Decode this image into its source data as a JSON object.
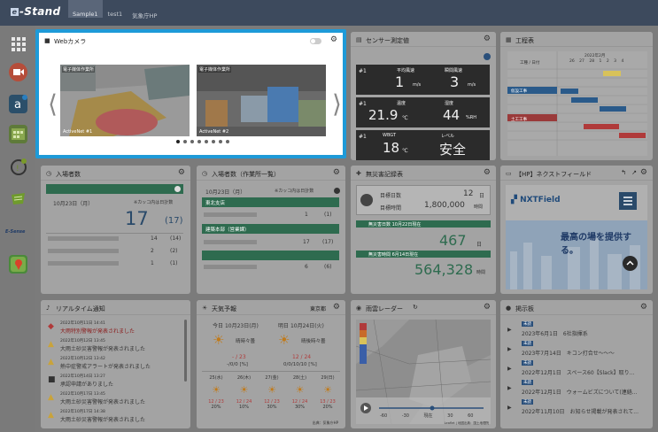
{
  "app": {
    "logo_mark": "e",
    "logo_text": "-Stand"
  },
  "tabs": [
    {
      "label": "Sample1"
    },
    {
      "label": "test1"
    },
    {
      "label": "気象庁HP"
    }
  ],
  "sidebar": {
    "esense_label": "E-Sense"
  },
  "webcam": {
    "title": "Webカメラ",
    "cams": [
      {
        "title": "電子媒体作業所",
        "caption": "ActiveNet #1"
      },
      {
        "title": "電子媒体作業所",
        "caption": "ActiveNet #2"
      }
    ],
    "dots": 8
  },
  "sensor": {
    "title": "センサー測定値",
    "blocks": [
      {
        "id": "#1",
        "labels": [
          "平均風速",
          "瞬間風速"
        ],
        "values": [
          "1",
          "3"
        ],
        "units": [
          "m/s",
          "m/s"
        ]
      },
      {
        "id": "#1",
        "labels": [
          "温度",
          "湿度"
        ],
        "values": [
          "21.9",
          "44"
        ],
        "units": [
          "℃",
          "%RH"
        ]
      },
      {
        "id": "#1",
        "labels": [
          "WBGT",
          "レベル"
        ],
        "values": [
          "18",
          "安全"
        ],
        "units": [
          "℃",
          ""
        ]
      }
    ]
  },
  "schedule": {
    "title": "工程表",
    "month": "2022年2月",
    "col_label": "工種 / 日付",
    "days": [
      "26",
      "27",
      "28",
      "1",
      "2",
      "3",
      "4"
    ],
    "rows": [
      "準備",
      "仮設工事",
      "杭打工事",
      "既製杭工事",
      "躯体工事",
      "鉄骨工事",
      "土工事1",
      "土工事2",
      "土工事3"
    ],
    "row_labels": [
      "仮設工事",
      "基礎工事",
      "土工工事",
      "鉄筋工事"
    ]
  },
  "entry": {
    "title": "入場者数",
    "date": "10月23日（月）",
    "note": "※カッコ内は日計数",
    "total": "17",
    "total_sub": "(17)",
    "rows": [
      {
        "v": "14",
        "s": "(14)"
      },
      {
        "v": "2",
        "s": "(2)"
      },
      {
        "v": "1",
        "s": "(1)"
      }
    ]
  },
  "entry_site": {
    "title": "入場者数（作業所一覧）",
    "date": "10月23日（月）",
    "note": "※カッコ内は日計数",
    "groups": [
      {
        "name": "東北支店",
        "v": "1",
        "s": "(1)"
      },
      {
        "name": "建築本部（営業課）",
        "v": "17",
        "s": "(17)"
      },
      {
        "name": "",
        "v": "6",
        "s": "(6)"
      }
    ]
  },
  "safety": {
    "title": "無災害記録表",
    "labels": [
      "目標日数",
      "目標時間"
    ],
    "goal_days": "12",
    "goal_days_unit": "日",
    "goal_hours": "1,800,000",
    "goal_hours_unit": "時間",
    "start1": "無災害日数 10月22日現在",
    "days": "467",
    "days_unit": "日",
    "start2": "無災害時間 6月14日現在",
    "hours": "564,328",
    "hours_unit": "時間"
  },
  "nxt": {
    "title": "【HP】ネクストフィールド",
    "brand": "NXTField",
    "banner": "最高の場を提供する。"
  },
  "realtime": {
    "title": "リアルタイム通知",
    "items": [
      {
        "t": "2022年10月11日 14:41",
        "m": "大雨特別警報が発表されました"
      },
      {
        "t": "2022年10月12日 13:45",
        "m": "大雨土砂災害警報が発表されました"
      },
      {
        "t": "2022年10月12日 13:42",
        "m": "熱中症警戒アラートが発表されました"
      },
      {
        "t": "2022年10月14日 13:27",
        "m": "承認申請がありました"
      },
      {
        "t": "2022年10月17日 13:45",
        "m": "大雨土砂災害警報が発表されました"
      },
      {
        "t": "2022年10月17日 14:38",
        "m": "大雨土砂災害警報が発表されました"
      }
    ]
  },
  "weather": {
    "title": "天気予報",
    "region": "東京都",
    "today_label": "今日",
    "today": "10月23日(月)",
    "tomorrow_label": "明日",
    "tomorrow": "10月24日(火)",
    "today_desc": "晴時々曇",
    "tomorrow_desc": "晴後時々曇",
    "today_temp": "- / 23",
    "tomorrow_temp": "12 / 24",
    "today_rain": "-/0/0 [%]",
    "tomorrow_rain": "0/0/10/10 [%]",
    "week": [
      {
        "d": "25(水)",
        "t": "12 / 23",
        "p": "20%"
      },
      {
        "d": "26(木)",
        "t": "12 / 24",
        "p": "10%"
      },
      {
        "d": "27(金)",
        "t": "12 / 23",
        "p": "30%"
      },
      {
        "d": "28(土)",
        "t": "12 / 24",
        "p": "30%"
      },
      {
        "d": "29(日)",
        "t": "13 / 23",
        "p": "20%"
      }
    ],
    "source": "出典：気象庁HP"
  },
  "radar": {
    "title": "雨雲レーダー",
    "scale": [
      "-60",
      "-30",
      "現在",
      "30",
      "60"
    ],
    "credit": "Leaflet | 地図出典：国土地理院"
  },
  "board": {
    "title": "掲示板",
    "tag": "未読",
    "items": [
      {
        "d": "2023年6月1日",
        "m": "6社指揮系"
      },
      {
        "d": "2023年7月14日",
        "m": "キコン打合せ～～～"
      },
      {
        "d": "2022年12月1日",
        "m": "スペース60【Slack】取り..."
      },
      {
        "d": "2022年12月1日",
        "m": "ウォームビズについて(連絡..."
      },
      {
        "d": "2022年11月10日",
        "m": "お知らせ掲載が発表されて..."
      }
    ]
  }
}
